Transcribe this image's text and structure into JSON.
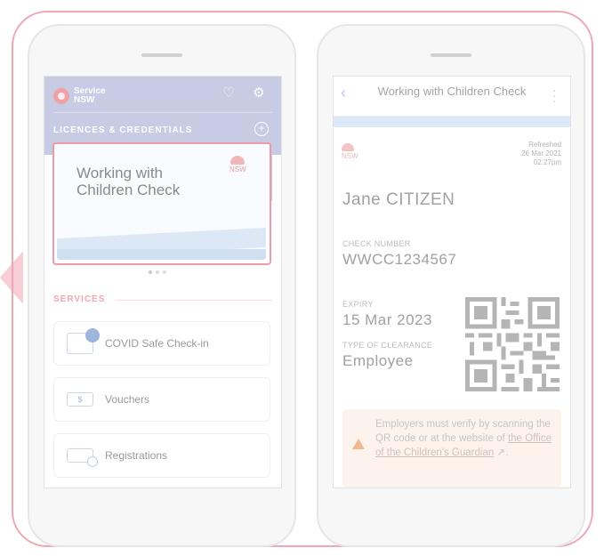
{
  "left_screen": {
    "brand": "Service NSW",
    "licences_title": "LICENCES & CREDENTIALS",
    "card": {
      "title": "Working with Children Check",
      "badge": "NSW"
    },
    "services_title": "SERVICES",
    "services": [
      {
        "label": "COVID Safe Check-in",
        "icon": "qr-checkin-icon"
      },
      {
        "label": "Vouchers",
        "icon": "voucher-icon",
        "icon_text": "$"
      },
      {
        "label": "Registrations",
        "icon": "registration-icon"
      }
    ]
  },
  "right_screen": {
    "title": "Working with Children Check",
    "badge": "NSW",
    "refreshed_label": "Refreshed",
    "refreshed_date": "26 Mar 2021",
    "refreshed_time": "02:27pm",
    "holder_name": "Jane CITIZEN",
    "check_number_label": "CHECK NUMBER",
    "check_number": "WWCC1234567",
    "expiry_label": "EXPIRY",
    "expiry": "15 Mar 2023",
    "clearance_label": "TYPE OF CLEARANCE",
    "clearance": "Employee",
    "warning_text": "Employers must verify by scanning the QR code or at the website of",
    "warning_link": "the Office of the Children's Guardian",
    "warning_end": "."
  },
  "colors": {
    "frame": "#efa7b6",
    "header": "#c7cce4",
    "accent_pink": "#f1a7b3"
  }
}
